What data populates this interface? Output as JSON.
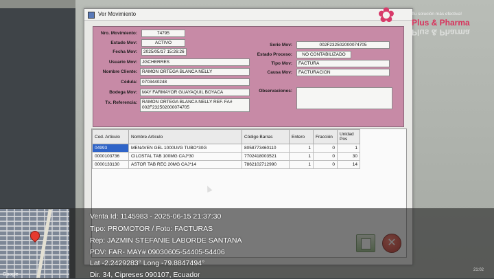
{
  "window": {
    "title": "Ver Movimiento"
  },
  "form": {
    "nro_movimiento": {
      "label": "Nro. Movimiento:",
      "value": "74795"
    },
    "estado_mov": {
      "label": "Estado Mov:",
      "value": "ACTIVO"
    },
    "fecha_mov": {
      "label": "Fecha Mov:",
      "value": "2025/05/17 15:26:26"
    },
    "usuario_mov": {
      "label": "Usuario Mov:",
      "value": "JGCHERRES"
    },
    "nombre_cliente": {
      "label": "Nombre Cliente:",
      "value": "RAMON ORTEGA BLANCA NELLY"
    },
    "cedula": {
      "label": "Cédula:",
      "value": "0703440248"
    },
    "bodega_mov": {
      "label": "Bodega Mov:",
      "value": "MAY FARMAYOR GUAYAQUIL BOYACA"
    },
    "tx_referencia": {
      "label": "Tx. Referencia:",
      "value": "RAMON ORTEGA BLANCA NELLY REF. FA# 002F232502000074705"
    },
    "serie_mov": {
      "label": "Serie Mov:",
      "value": "002F232502000074705"
    },
    "estado_proceso": {
      "label": "Estado Proceso:",
      "value": "NO CONTABILIZADO"
    },
    "tipo_mov": {
      "label": "Tipo Mov:",
      "value": "FACTURA"
    },
    "causa_mov": {
      "label": "Causa Mov:",
      "value": "FACTURACION"
    },
    "observaciones": {
      "label": "Observaciones:",
      "value": ""
    }
  },
  "grid": {
    "columns": [
      "Cod. Articulo",
      "Nombre Articulo",
      "Código Barras",
      "Entero",
      "Fracción",
      "Unidad Pos"
    ],
    "rows": [
      {
        "cod": "04993",
        "nombre": "MENAVEN GEL 1000UI/G TUBO*30G",
        "barras": "8058773460110",
        "entero": "1",
        "fraccion": "0",
        "unidad": "1"
      },
      {
        "cod": "0000103736",
        "nombre": "CILOSTAL TAB 100MG CAJ*30",
        "barras": "7702418003521",
        "entero": "1",
        "fraccion": "0",
        "unidad": "30"
      },
      {
        "cod": "0000133130",
        "nombre": "ASTOR TAB REC 20MG CAJ*14",
        "barras": "7862102712990",
        "entero": "1",
        "fraccion": "0",
        "unidad": "14"
      }
    ]
  },
  "logo": {
    "tagline": "Tu solución más efectiva!",
    "brand": "Plus & Pharma"
  },
  "stamp": {
    "line1": "Venta Id: 1145983 - 2025-06-15 21:37:30",
    "line2": "Tipo: PROMOTOR / Foto: FACTURAS",
    "line3": "Rep: JAZMIN STEFANIE LABORDE SANTANA",
    "line4": "PDV: FAR- MAY# 09030605-54405-54406",
    "line5": "Lat -2.2429283° Long -79.8847494°",
    "line6": "Dir. 34, Cipreses 090107, Ecuador"
  },
  "map": {
    "attribution": "Google"
  },
  "taskbar": {
    "time": "21:02"
  },
  "colors": {
    "panel": "#c78aa6",
    "selected_row": "#2f64c8",
    "brand": "#d8315b"
  }
}
